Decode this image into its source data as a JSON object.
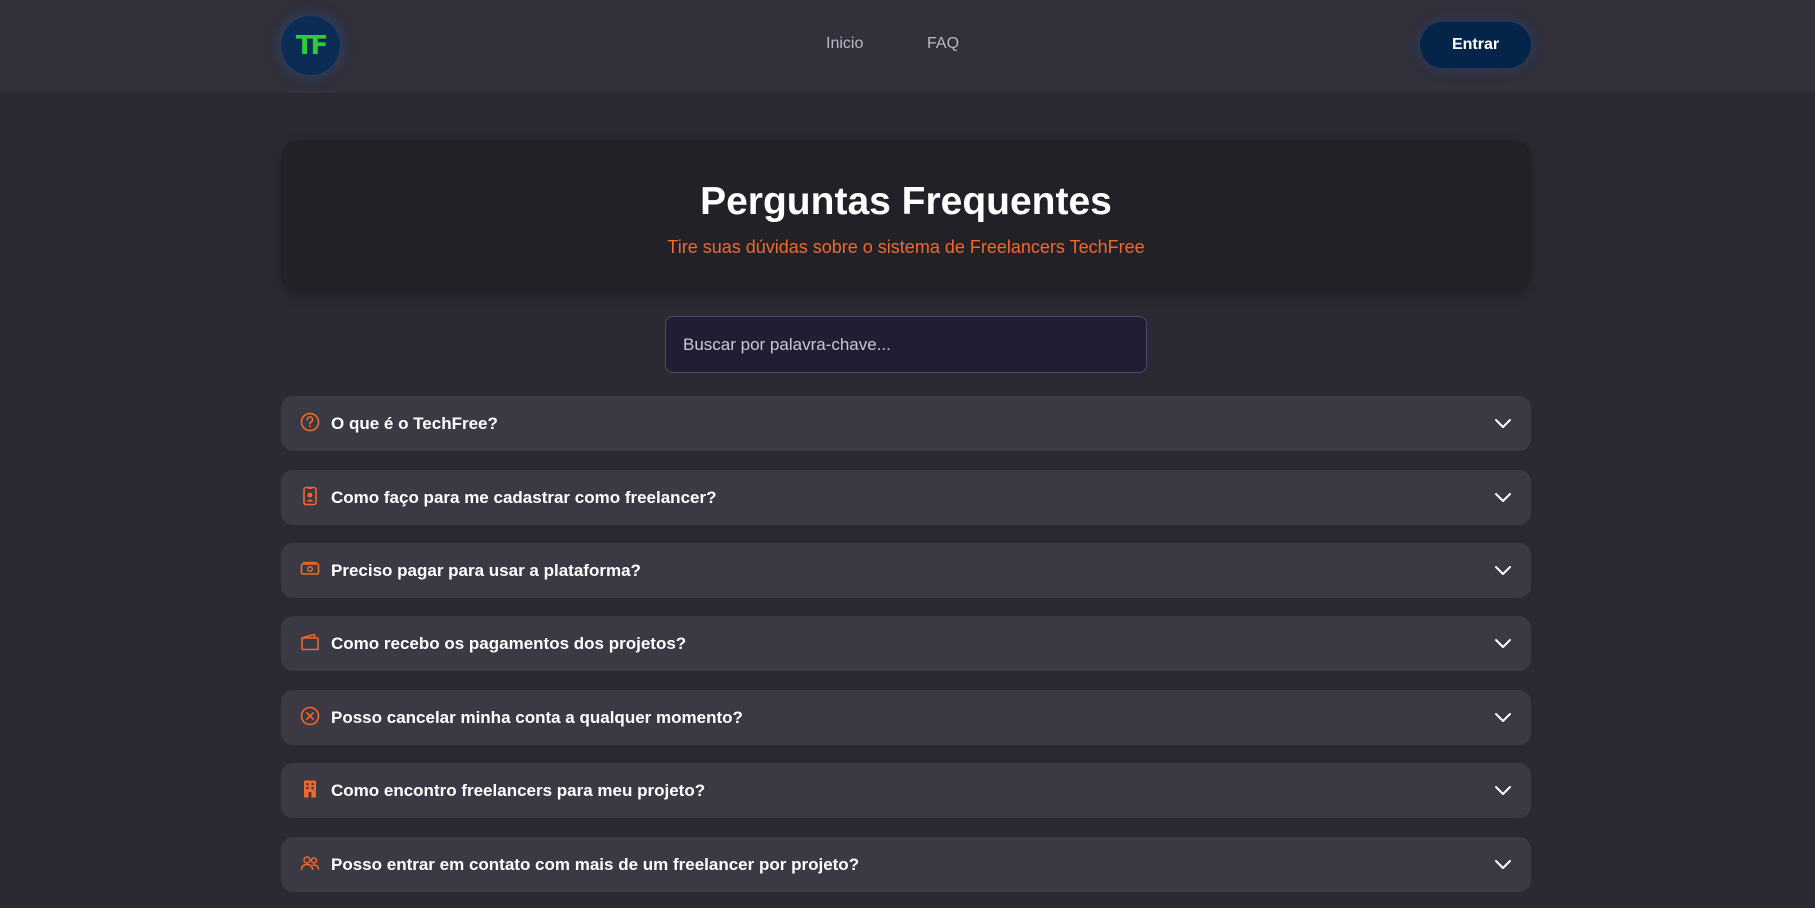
{
  "navbar": {
    "logo_text": "TF",
    "links": [
      {
        "label": "Inicio"
      },
      {
        "label": "FAQ"
      }
    ],
    "login_label": "Entrar"
  },
  "hero": {
    "title": "Perguntas Frequentes",
    "subtitle": "Tire suas dúvidas sobre o sistema de Freelancers TechFree"
  },
  "search": {
    "placeholder": "Buscar por palavra-chave..."
  },
  "faq": [
    {
      "icon": "question-circle-icon",
      "question": "O que é o TechFree?"
    },
    {
      "icon": "id-badge-icon",
      "question": "Como faço para me cadastrar como freelancer?"
    },
    {
      "icon": "money-bill-icon",
      "question": "Preciso pagar para usar a plataforma?"
    },
    {
      "icon": "wallet-icon",
      "question": "Como recebo os pagamentos dos projetos?"
    },
    {
      "icon": "x-circle-icon",
      "question": "Posso cancelar minha conta a qualquer momento?"
    },
    {
      "icon": "building-icon",
      "question": "Como encontro freelancers para meu projeto?"
    },
    {
      "icon": "users-icon",
      "question": "Posso entrar em contato com mais de um freelancer por projeto?"
    }
  ],
  "colors": {
    "accent": "#f2682a",
    "logo_green": "#2ecc3a",
    "button_bg": "#05244a",
    "page_bg": "#2b2a33",
    "card_bg": "#3a3944"
  }
}
